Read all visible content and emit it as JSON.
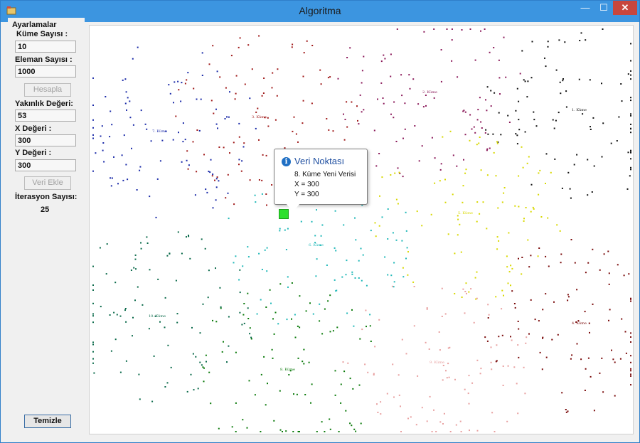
{
  "window": {
    "title": "Algoritma",
    "min_glyph": "—",
    "max_glyph": "☐",
    "close_glyph": "✕"
  },
  "sidebar": {
    "group_label": "Ayarlamalar",
    "kume_label": "Küme Sayısı :",
    "kume_value": "10",
    "eleman_label": "Eleman Sayısı :",
    "eleman_value": "1000",
    "hesapla_label": "Hesapla",
    "yakinlik_label": "Yakınlık Değeri:",
    "yakinlik_value": "53",
    "x_label": "X Değeri :",
    "x_value": "300",
    "y_label": "Y Değeri :",
    "y_value": "300",
    "veri_ekle_label": "Veri Ekle",
    "iterasyon_label": "İterasyon Sayısı:",
    "iterasyon_value": "25",
    "temizle_label": "Temizle"
  },
  "tooltip": {
    "title": "Veri Noktası",
    "line1": "8. Küme Yeni Verisi",
    "line2": "X = 300",
    "line3": "Y = 300"
  },
  "clusters": [
    {
      "label": "1. Küme",
      "color": "#111111"
    },
    {
      "label": "2. Küme",
      "color": "#8b1a5a"
    },
    {
      "label": "3. Küme",
      "color": "#a01a1a"
    },
    {
      "label": "4. Küme",
      "color": "#7a0a0a"
    },
    {
      "label": "5. Küme",
      "color": "#d8d800"
    },
    {
      "label": "6. Küme",
      "color": "#20b8b8"
    },
    {
      "label": "7. Küme",
      "color": "#1a2aa8"
    },
    {
      "label": "8. Küme",
      "color": "#0a7a0a"
    },
    {
      "label": "9. Küme",
      "color": "#e8a0a0"
    },
    {
      "label": "10. Küme",
      "color": "#0a6a4a"
    }
  ],
  "accent": "#2ee02e"
}
